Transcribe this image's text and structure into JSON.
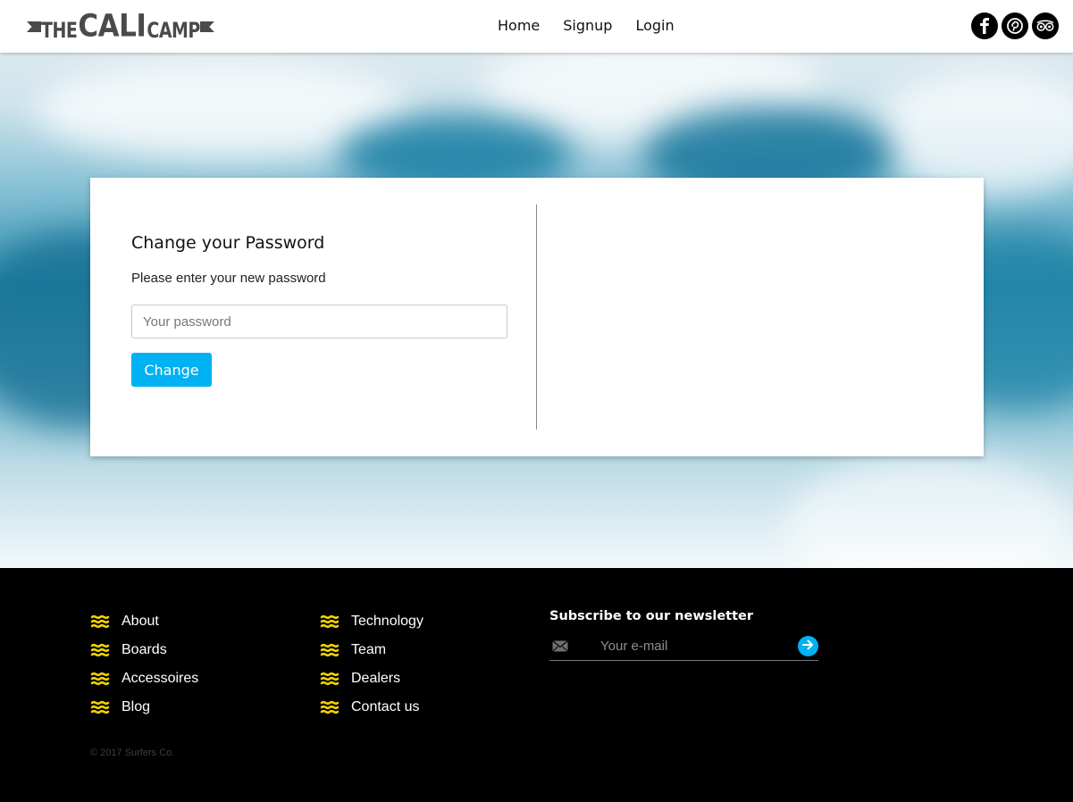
{
  "brand": {
    "logo": {
      "the": "THE",
      "cali": "CALI",
      "camp": "CAMP"
    }
  },
  "nav": {
    "items": [
      {
        "label": "Home"
      },
      {
        "label": "Signup"
      },
      {
        "label": "Login"
      }
    ]
  },
  "social": [
    "facebook-icon",
    "pinterest-icon",
    "tripadvisor-icon"
  ],
  "form": {
    "title": "Change your Password",
    "subtitle": "Please enter your new password",
    "password_placeholder": "Your password",
    "submit_label": "Change"
  },
  "footer": {
    "col1": [
      {
        "label": "About"
      },
      {
        "label": "Boards"
      },
      {
        "label": "Accessoires"
      },
      {
        "label": "Blog"
      }
    ],
    "col2": [
      {
        "label": "Technology"
      },
      {
        "label": "Team"
      },
      {
        "label": "Dealers"
      },
      {
        "label": "Contact us"
      }
    ],
    "newsletter": {
      "title": "Subscribe to our newsletter",
      "email_placeholder": "Your e-mail"
    },
    "copyright": "© 2017 Surfers Co."
  },
  "colors": {
    "accent": "#00b1f3",
    "wave_icon": "#f5d400",
    "footer_bg": "#000000",
    "logo": "#4a4a4a"
  }
}
